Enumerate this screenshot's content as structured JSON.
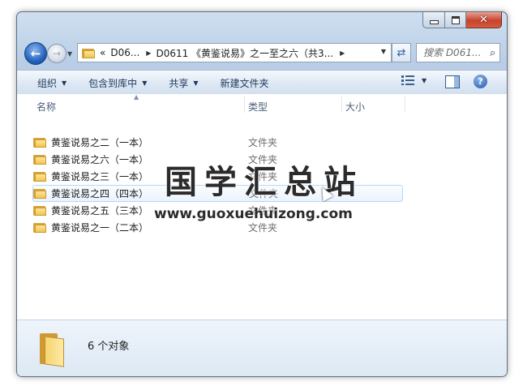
{
  "window": {
    "buttons": {
      "minimize": "minimize",
      "maximize": "maximize",
      "close": "✕"
    }
  },
  "nav": {
    "back": "back-arrow-icon",
    "forward": "forward-arrow-icon",
    "address": {
      "overflow": "«",
      "segment1": "D06...",
      "segment2": "D0611 《黄鉴说易》之一至之六（共3..."
    },
    "search": {
      "placeholder": "搜索 D061..."
    }
  },
  "toolbar": {
    "organize": "组织",
    "include_library": "包含到库中",
    "share": "共享",
    "new_folder": "新建文件夹"
  },
  "columns": {
    "name": "名称",
    "type": "类型",
    "size": "大小"
  },
  "files": [
    {
      "name": "黄鉴说易之二（一本）",
      "type": "文件夹"
    },
    {
      "name": "黄鉴说易之六（一本）",
      "type": "文件夹"
    },
    {
      "name": "黄鉴说易之三（一本）",
      "type": "文件夹"
    },
    {
      "name": "黄鉴说易之四（四本）",
      "type": "文件夹"
    },
    {
      "name": "黄鉴说易之五（三本）",
      "type": "文件夹"
    },
    {
      "name": "黄鉴说易之一（二本）",
      "type": "文件夹"
    }
  ],
  "details": {
    "count": "6 个对象"
  },
  "watermark": {
    "title": "国学汇总站",
    "url": "www.guoxuehuizong.com"
  }
}
